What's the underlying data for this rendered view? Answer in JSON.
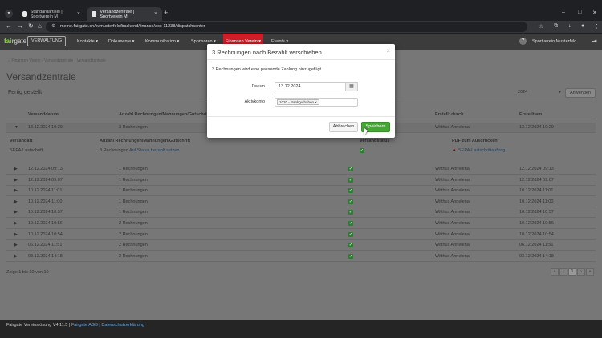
{
  "browser": {
    "tabs": [
      {
        "title": "Standardartikel | Sportverein M",
        "active": false
      },
      {
        "title": "Versandzentrale | Sportverein M",
        "active": true
      }
    ],
    "url": "meine.fairgate.ch/svmusterfeld/backend/finance/acc-11238/dispatchcenter"
  },
  "app": {
    "logo_main": "fair",
    "logo_sub": "gate",
    "mode_button": "VERWALTUNG",
    "nav": [
      "Kontakte",
      "Dokumente",
      "Kommunikation",
      "Sponsoren",
      "Finanzen Verein",
      "Events"
    ],
    "club_name": "Sportverein Musterfeld"
  },
  "page": {
    "breadcrumb": [
      "Finanzen Verein",
      "Versandzentrale",
      "Versandzentrale"
    ],
    "title": "Versandzentrale",
    "status_label": "Fertig gestellt",
    "year": "2024",
    "apply_button": "Anwenden",
    "columns": [
      "Versanddatum",
      "Anzahl Rechnungen/Mahnungen/Gutschrift",
      "Erstellt durch",
      "Erstellt am"
    ],
    "expanded_row": {
      "date": "13.12.2024 10:29",
      "count": "3 Rechnungen",
      "by": "Witthus Annelena",
      "at": "13.12.2024 10:29"
    },
    "detail_columns": [
      "Versandart",
      "Anzahl Rechnungen/Mahnungen/Gutschrift",
      "Versandstatus",
      "PDF zum Ausdrucken"
    ],
    "detail_row": {
      "type": "SEPA-Lastschrift",
      "count": "3 Rechnungen",
      "action": "Auf Status bezahlt setzen",
      "pdf": "SEPA-Lastschriftauftrag"
    },
    "rows": [
      {
        "date": "12.12.2024 09:13",
        "count": "1 Rechnungen",
        "by": "Witthus Annelena",
        "at": "12.12.2024 09:13"
      },
      {
        "date": "12.12.2024 09:07",
        "count": "1 Rechnungen",
        "by": "Witthus Annelena",
        "at": "12.12.2024 09:07"
      },
      {
        "date": "10.12.2024 11:01",
        "count": "1 Rechnungen",
        "by": "Witthus Annelena",
        "at": "10.12.2024 11:01"
      },
      {
        "date": "10.12.2024 11:00",
        "count": "1 Rechnungen",
        "by": "Witthus Annelena",
        "at": "10.12.2024 11:00"
      },
      {
        "date": "10.12.2024 10:57",
        "count": "1 Rechnungen",
        "by": "Witthus Annelena",
        "at": "10.12.2024 10:57"
      },
      {
        "date": "10.12.2024 10:56",
        "count": "2 Rechnungen",
        "by": "Witthus Annelena",
        "at": "10.12.2024 10:56"
      },
      {
        "date": "10.12.2024 10:54",
        "count": "2 Rechnungen",
        "by": "Witthus Annelena",
        "at": "10.12.2024 10:54"
      },
      {
        "date": "06.12.2024 11:51",
        "count": "2 Rechnungen",
        "by": "Witthus Annelena",
        "at": "06.12.2024 11:51"
      },
      {
        "date": "03.12.2024 14:18",
        "count": "2 Rechnungen",
        "by": "Witthus Annelena",
        "at": "03.12.2024 14:18"
      }
    ],
    "pager_text": "Zeige 1 bis 10 von 10",
    "current_page": "1"
  },
  "modal": {
    "title": "3 Rechnungen nach Bezahlt verschieben",
    "message": "3 Rechnungen wird eine passende Zahlung hinzugefügt.",
    "date_label": "Datum",
    "date_value": "13.12.2024",
    "account_label": "Aktivkonto",
    "account_value": "1020 - Bankguthaben",
    "cancel_button": "Abbrechen",
    "save_button": "Speichern"
  },
  "footer": {
    "version": "Fairgate Vereinslösung V4.11.5",
    "links": [
      "Fairgate AGB",
      "Datenschutzerklärung"
    ]
  }
}
